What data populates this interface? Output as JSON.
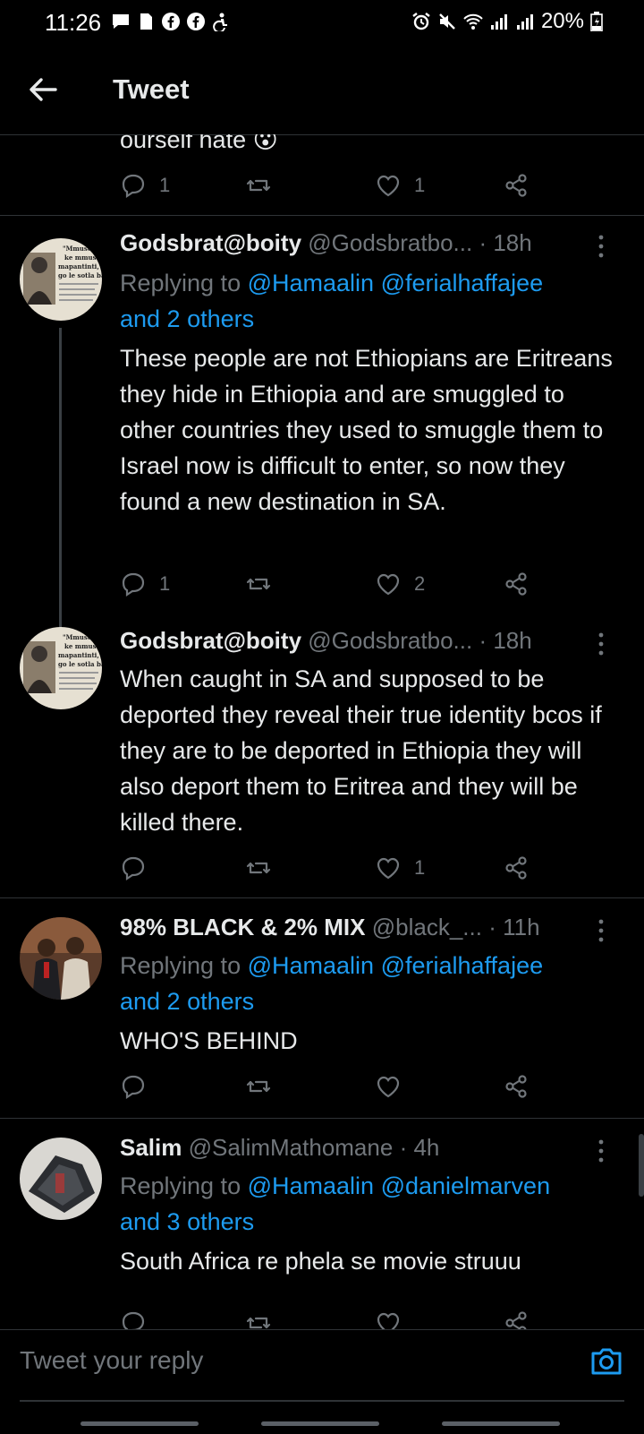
{
  "status_bar": {
    "time": "11:26",
    "battery": "20%"
  },
  "header": {
    "title": "Tweet",
    "back_icon": "arrow-left-icon"
  },
  "colors": {
    "background": "#000000",
    "text": "#e7e9ea",
    "muted": "#71767b",
    "link": "#1d9bf0",
    "divider": "#2f3336"
  },
  "partial_tweet": {
    "text": "ourself hate",
    "emoji": "😮",
    "replies": "1",
    "retweets": "",
    "likes": "1"
  },
  "tweets": [
    {
      "name": "Godsbrat@boity",
      "handle": "@Godsbratbo...",
      "time": "· 18h",
      "replying_prefix": "Replying to ",
      "mention1": "@Hamaalin",
      "mention2": "@ferialhaffajee",
      "and_others": "and 2 others",
      "text": "These people are not Ethiopians are Eritreans they hide in Ethiopia and are smuggled to other countries they used to smuggle them to Israel now is difficult to enter, so now they found a new destination in SA.",
      "replies": "1",
      "retweets": "",
      "likes": "2"
    },
    {
      "name": "Godsbrat@boity",
      "handle": "@Godsbratbo...",
      "time": "· 18h",
      "text": "When caught in SA and supposed to be deported they reveal their true identity bcos if they are to be deported in Ethiopia they will also deport them to Eritrea and they will be killed there.",
      "replies": "",
      "retweets": "",
      "likes": "1"
    },
    {
      "name": "98% BLACK & 2% MIX",
      "handle": "@black_...",
      "time": "· 11h",
      "replying_prefix": "Replying to ",
      "mention1": "@Hamaalin",
      "mention2": "@ferialhaffajee",
      "and_others": "and 2 others",
      "text": "WHO'S BEHIND",
      "replies": "",
      "retweets": "",
      "likes": ""
    },
    {
      "name": "Salim",
      "handle": "@SalimMathomane",
      "time": "· 4h",
      "replying_prefix": "Replying to ",
      "mention1": "@Hamaalin",
      "mention2": "@danielmarven",
      "and_others": "and 3 others",
      "text": "South Africa re phela se movie struuu"
    }
  ],
  "avatar_text": {
    "line1": "\"Mmuso wa",
    "line2": "ke mmuso",
    "line3": "mapantinti, o ti",
    "line4": "go le sotla banak"
  },
  "compose": {
    "placeholder": "Tweet your reply",
    "camera_icon": "camera-icon"
  }
}
